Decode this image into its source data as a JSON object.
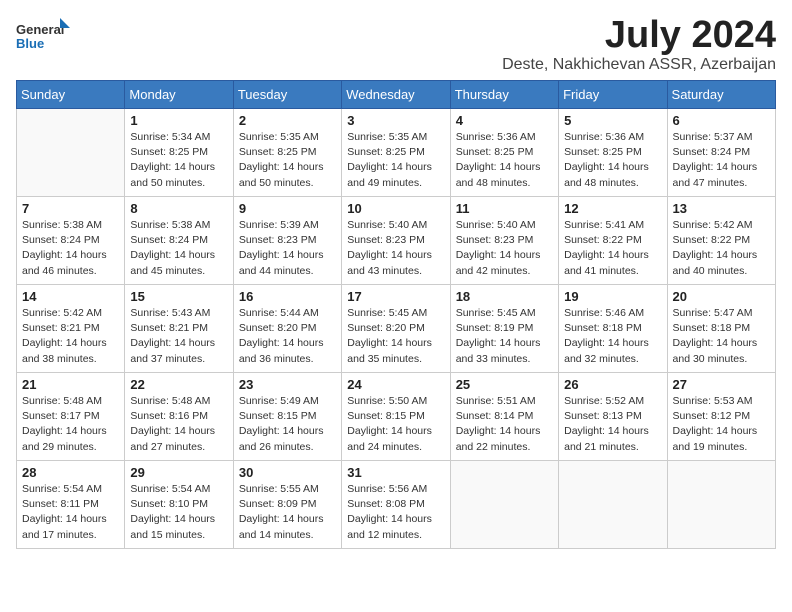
{
  "logo": {
    "line1": "General",
    "line2": "Blue"
  },
  "title": "July 2024",
  "location": "Deste, Nakhichevan ASSR, Azerbaijan",
  "days_of_week": [
    "Sunday",
    "Monday",
    "Tuesday",
    "Wednesday",
    "Thursday",
    "Friday",
    "Saturday"
  ],
  "weeks": [
    [
      {
        "day": "",
        "info": ""
      },
      {
        "day": "1",
        "info": "Sunrise: 5:34 AM\nSunset: 8:25 PM\nDaylight: 14 hours\nand 50 minutes."
      },
      {
        "day": "2",
        "info": "Sunrise: 5:35 AM\nSunset: 8:25 PM\nDaylight: 14 hours\nand 50 minutes."
      },
      {
        "day": "3",
        "info": "Sunrise: 5:35 AM\nSunset: 8:25 PM\nDaylight: 14 hours\nand 49 minutes."
      },
      {
        "day": "4",
        "info": "Sunrise: 5:36 AM\nSunset: 8:25 PM\nDaylight: 14 hours\nand 48 minutes."
      },
      {
        "day": "5",
        "info": "Sunrise: 5:36 AM\nSunset: 8:25 PM\nDaylight: 14 hours\nand 48 minutes."
      },
      {
        "day": "6",
        "info": "Sunrise: 5:37 AM\nSunset: 8:24 PM\nDaylight: 14 hours\nand 47 minutes."
      }
    ],
    [
      {
        "day": "7",
        "info": "Sunrise: 5:38 AM\nSunset: 8:24 PM\nDaylight: 14 hours\nand 46 minutes."
      },
      {
        "day": "8",
        "info": "Sunrise: 5:38 AM\nSunset: 8:24 PM\nDaylight: 14 hours\nand 45 minutes."
      },
      {
        "day": "9",
        "info": "Sunrise: 5:39 AM\nSunset: 8:23 PM\nDaylight: 14 hours\nand 44 minutes."
      },
      {
        "day": "10",
        "info": "Sunrise: 5:40 AM\nSunset: 8:23 PM\nDaylight: 14 hours\nand 43 minutes."
      },
      {
        "day": "11",
        "info": "Sunrise: 5:40 AM\nSunset: 8:23 PM\nDaylight: 14 hours\nand 42 minutes."
      },
      {
        "day": "12",
        "info": "Sunrise: 5:41 AM\nSunset: 8:22 PM\nDaylight: 14 hours\nand 41 minutes."
      },
      {
        "day": "13",
        "info": "Sunrise: 5:42 AM\nSunset: 8:22 PM\nDaylight: 14 hours\nand 40 minutes."
      }
    ],
    [
      {
        "day": "14",
        "info": "Sunrise: 5:42 AM\nSunset: 8:21 PM\nDaylight: 14 hours\nand 38 minutes."
      },
      {
        "day": "15",
        "info": "Sunrise: 5:43 AM\nSunset: 8:21 PM\nDaylight: 14 hours\nand 37 minutes."
      },
      {
        "day": "16",
        "info": "Sunrise: 5:44 AM\nSunset: 8:20 PM\nDaylight: 14 hours\nand 36 minutes."
      },
      {
        "day": "17",
        "info": "Sunrise: 5:45 AM\nSunset: 8:20 PM\nDaylight: 14 hours\nand 35 minutes."
      },
      {
        "day": "18",
        "info": "Sunrise: 5:45 AM\nSunset: 8:19 PM\nDaylight: 14 hours\nand 33 minutes."
      },
      {
        "day": "19",
        "info": "Sunrise: 5:46 AM\nSunset: 8:18 PM\nDaylight: 14 hours\nand 32 minutes."
      },
      {
        "day": "20",
        "info": "Sunrise: 5:47 AM\nSunset: 8:18 PM\nDaylight: 14 hours\nand 30 minutes."
      }
    ],
    [
      {
        "day": "21",
        "info": "Sunrise: 5:48 AM\nSunset: 8:17 PM\nDaylight: 14 hours\nand 29 minutes."
      },
      {
        "day": "22",
        "info": "Sunrise: 5:48 AM\nSunset: 8:16 PM\nDaylight: 14 hours\nand 27 minutes."
      },
      {
        "day": "23",
        "info": "Sunrise: 5:49 AM\nSunset: 8:15 PM\nDaylight: 14 hours\nand 26 minutes."
      },
      {
        "day": "24",
        "info": "Sunrise: 5:50 AM\nSunset: 8:15 PM\nDaylight: 14 hours\nand 24 minutes."
      },
      {
        "day": "25",
        "info": "Sunrise: 5:51 AM\nSunset: 8:14 PM\nDaylight: 14 hours\nand 22 minutes."
      },
      {
        "day": "26",
        "info": "Sunrise: 5:52 AM\nSunset: 8:13 PM\nDaylight: 14 hours\nand 21 minutes."
      },
      {
        "day": "27",
        "info": "Sunrise: 5:53 AM\nSunset: 8:12 PM\nDaylight: 14 hours\nand 19 minutes."
      }
    ],
    [
      {
        "day": "28",
        "info": "Sunrise: 5:54 AM\nSunset: 8:11 PM\nDaylight: 14 hours\nand 17 minutes."
      },
      {
        "day": "29",
        "info": "Sunrise: 5:54 AM\nSunset: 8:10 PM\nDaylight: 14 hours\nand 15 minutes."
      },
      {
        "day": "30",
        "info": "Sunrise: 5:55 AM\nSunset: 8:09 PM\nDaylight: 14 hours\nand 14 minutes."
      },
      {
        "day": "31",
        "info": "Sunrise: 5:56 AM\nSunset: 8:08 PM\nDaylight: 14 hours\nand 12 minutes."
      },
      {
        "day": "",
        "info": ""
      },
      {
        "day": "",
        "info": ""
      },
      {
        "day": "",
        "info": ""
      }
    ]
  ]
}
